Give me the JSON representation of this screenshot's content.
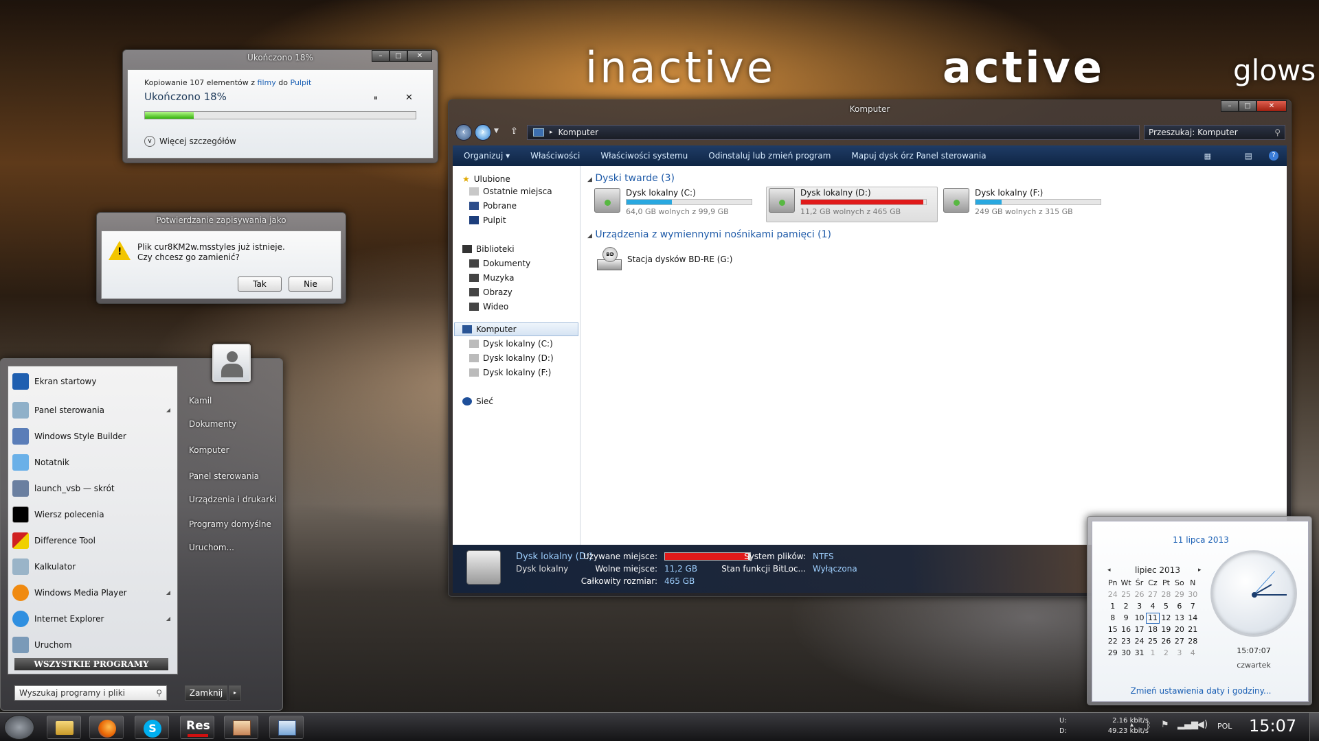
{
  "labels": {
    "inactive": "inactive",
    "active": "active",
    "glows": "glows"
  },
  "copy_dialog": {
    "title": "Ukończono 18%",
    "description_prefix": "Kopiowanie 107 elementów z",
    "source": "filmy",
    "middle": "do",
    "destination": "Pulpit",
    "heading": "Ukończono 18%",
    "progress": 0.18,
    "more_details": "Więcej szczegółów",
    "pause_glyph": "⏸",
    "close_glyph": "✕"
  },
  "confirm_dialog": {
    "title": "Potwierdzanie zapisywania jako",
    "line1": "Plik cur8KM2w.msstyles już istnieje.",
    "line2": "Czy chcesz go zamienić?",
    "yes": "Tak",
    "no": "Nie"
  },
  "explorer": {
    "title": "Komputer",
    "address": "Komputer",
    "search_placeholder": "Przeszukaj: Komputer",
    "commands": [
      "Organizuj ▾",
      "Właściwości",
      "Właściwości systemu",
      "Odinstaluj lub zmień program",
      "Mapuj dysk órz Panel sterowania"
    ],
    "nav": {
      "favorites": "Ulubione",
      "recent": "Ostatnie miejsca",
      "downloads": "Pobrane",
      "desktop": "Pulpit",
      "libraries": "Biblioteki",
      "documents": "Dokumenty",
      "music": "Muzyka",
      "pictures": "Obrazy",
      "video": "Wideo",
      "computer": "Komputer",
      "drive_c": "Dysk lokalny (C:)",
      "drive_d": "Dysk lokalny (D:)",
      "drive_f": "Dysk lokalny (F:)",
      "network": "Sieć"
    },
    "groups": {
      "hard_disks": "Dyski twarde (3)",
      "removable": "Urządzenia z wymiennymi nośnikami pamięci (1)"
    },
    "drives": [
      {
        "name": "Dysk lokalny (C:)",
        "free": "64,0 GB wolnych z 99,9 GB",
        "used_fraction": 0.36,
        "color": "#29a8e0"
      },
      {
        "name": "Dysk lokalny (D:)",
        "free": "11,2 GB wolnych z 465 GB",
        "used_fraction": 0.976,
        "color": "#e01a1a"
      },
      {
        "name": "Dysk lokalny (F:)",
        "free": "249 GB wolnych z 315 GB",
        "used_fraction": 0.21,
        "color": "#29a8e0"
      }
    ],
    "bd_drive": "Stacja dysków BD-RE (G:)",
    "details": {
      "name": "Dysk lokalny (D:)",
      "type": "Dysk lokalny",
      "used_label": "Używane miejsce:",
      "used_fraction": 0.976,
      "free_label": "Wolne miejsce:",
      "free_value": "11,2 GB",
      "total_label": "Całkowity rozmiar:",
      "total_value": "465 GB",
      "fs_label": "System plików:",
      "fs_value": "NTFS",
      "bitlocker_label": "Stan funkcji BitLoc...",
      "bitlocker_value": "Wyłączona"
    }
  },
  "start_menu": {
    "programs": [
      "Ekran startowy",
      "Panel sterowania",
      "Windows Style Builder",
      "Notatnik",
      "launch_vsb — skrót",
      "Wiersz polecenia",
      "Difference Tool",
      "Kalkulator",
      "Windows Media Player",
      "Internet Explorer",
      "Uruchom"
    ],
    "all_programs": "WSZYSTKIE PROGRAMY",
    "search_placeholder": "Wyszukaj programy i pliki",
    "right": [
      "Kamil",
      "Dokumenty",
      "Komputer",
      "Panel sterowania",
      "Urządzenia i drukarki",
      "Programy domyślne",
      "Uruchom..."
    ],
    "shutdown": "Zamknij"
  },
  "clock_flyout": {
    "date_long": "11 lipca 2013",
    "month": "lipiec 2013",
    "weekdays": [
      "Pn",
      "Wt",
      "Śr",
      "Cz",
      "Pt",
      "So",
      "N"
    ],
    "days": [
      "24",
      "25",
      "26",
      "27",
      "28",
      "29",
      "30",
      "1",
      "2",
      "3",
      "4",
      "5",
      "6",
      "7",
      "8",
      "9",
      "10",
      "11",
      "12",
      "13",
      "14",
      "15",
      "16",
      "17",
      "18",
      "19",
      "20",
      "21",
      "22",
      "23",
      "24",
      "25",
      "26",
      "27",
      "28",
      "29",
      "30",
      "31",
      "1",
      "2",
      "3",
      "4"
    ],
    "time": "15:07:07",
    "weekday": "czwartek",
    "settings_link": "Zmień ustawienia daty i godziny..."
  },
  "taskbar": {
    "net_up_label": "U:",
    "net_down_label": "D:",
    "net_up": "2.16 kbit/s",
    "net_down": "49.23 kbit/s",
    "lang": "POL",
    "clock": "15:07"
  }
}
